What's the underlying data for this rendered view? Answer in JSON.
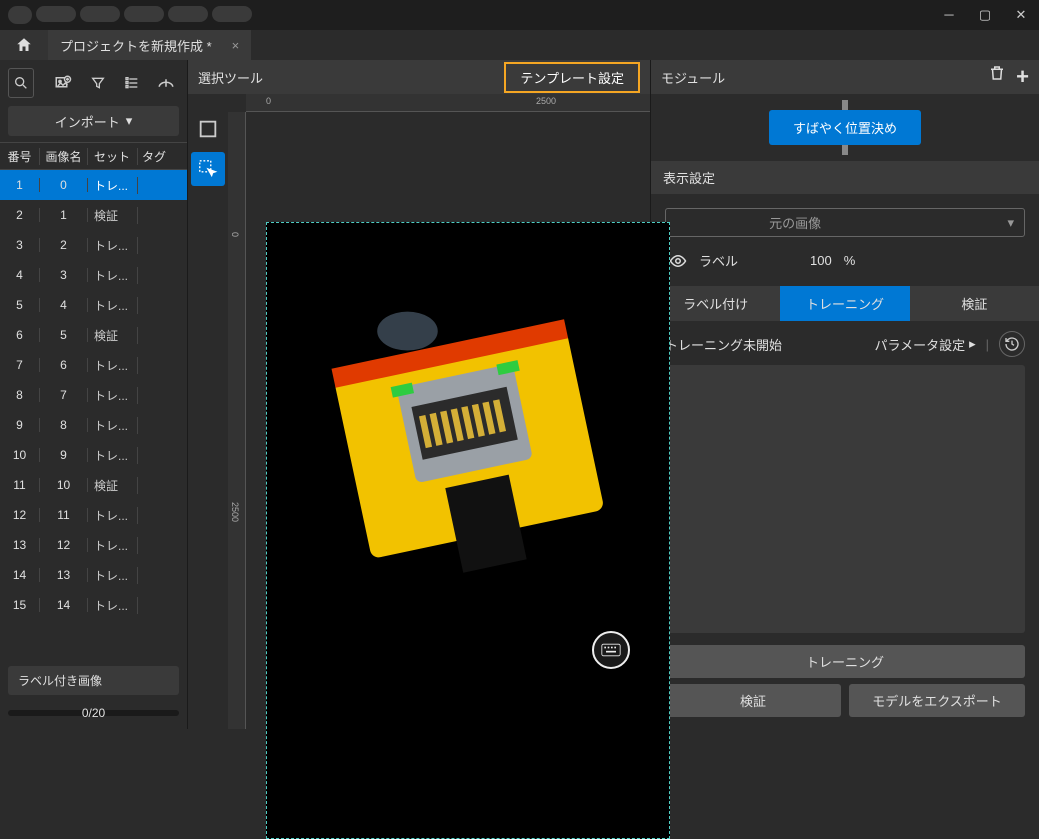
{
  "tab_title": "プロジェクトを新規作成 *",
  "left": {
    "import_label": "インポート",
    "headers": {
      "num": "番号",
      "name": "画像名",
      "set": "セット",
      "tag": "タグ"
    },
    "rows": [
      {
        "n": "1",
        "name": "0",
        "set": "トレ...",
        "sel": true
      },
      {
        "n": "2",
        "name": "1",
        "set": "検証"
      },
      {
        "n": "3",
        "name": "2",
        "set": "トレ..."
      },
      {
        "n": "4",
        "name": "3",
        "set": "トレ..."
      },
      {
        "n": "5",
        "name": "4",
        "set": "トレ..."
      },
      {
        "n": "6",
        "name": "5",
        "set": "検証"
      },
      {
        "n": "7",
        "name": "6",
        "set": "トレ..."
      },
      {
        "n": "8",
        "name": "7",
        "set": "トレ..."
      },
      {
        "n": "9",
        "name": "8",
        "set": "トレ..."
      },
      {
        "n": "10",
        "name": "9",
        "set": "トレ..."
      },
      {
        "n": "11",
        "name": "10",
        "set": "検証"
      },
      {
        "n": "12",
        "name": "11",
        "set": "トレ..."
      },
      {
        "n": "13",
        "name": "12",
        "set": "トレ..."
      },
      {
        "n": "14",
        "name": "13",
        "set": "トレ..."
      },
      {
        "n": "15",
        "name": "14",
        "set": "トレ..."
      }
    ],
    "labeled_images": "ラベル付き画像",
    "progress": "0/20"
  },
  "center": {
    "select_tool": "選択ツール",
    "template_btn": "テンプレート設定",
    "ruler": {
      "r0": "0",
      "r2500": "2500",
      "v0": "0",
      "v2500": "2500"
    }
  },
  "right": {
    "module": "モジュール",
    "quick_btn": "すばやく位置決め",
    "display_settings": "表示設定",
    "original_image": "元の画像",
    "label": "ラベル",
    "percent": "100",
    "percent_sym": "%",
    "tabs": {
      "labeling": "ラベル付け",
      "training": "トレーニング",
      "validation": "検証"
    },
    "train_status": "トレーニング未開始",
    "param": "パラメータ設定",
    "train_btn": "トレーニング",
    "verify_btn": "検証",
    "export_btn": "モデルをエクスポート"
  }
}
